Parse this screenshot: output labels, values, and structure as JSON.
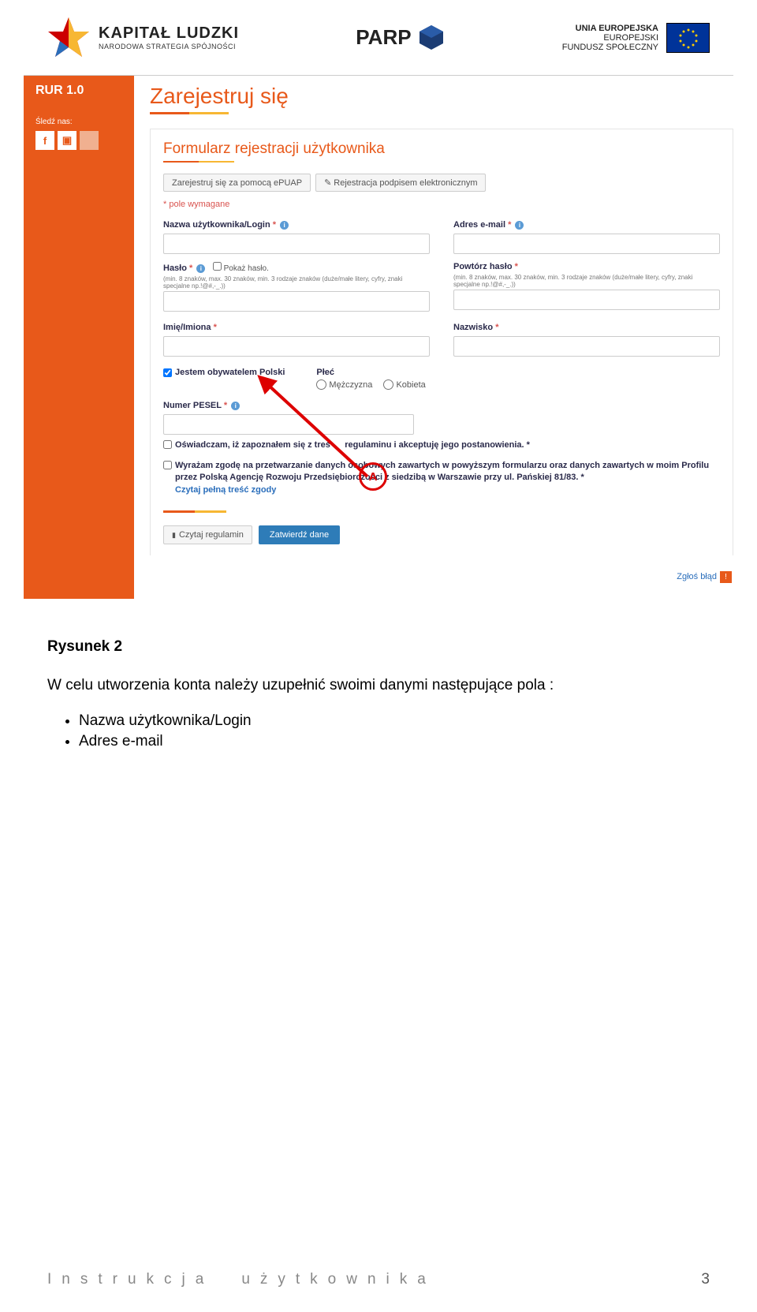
{
  "header": {
    "kl_title": "KAPITAŁ LUDZKI",
    "kl_sub": "NARODOWA STRATEGIA SPÓJNOŚCI",
    "parp": "PARP",
    "eu_line1": "UNIA EUROPEJSKA",
    "eu_line2": "EUROPEJSKI",
    "eu_line3": "FUNDUSZ SPOŁECZNY"
  },
  "sidebar": {
    "title": "RUR 1.0",
    "follow": "Śledź nas:",
    "soc_fb": "f",
    "soc_yt": "▣"
  },
  "main": {
    "h1": "Zarejestruj się",
    "h2": "Formularz rejestracji użytkownika",
    "btn_epuap": "Zarejestruj się za pomocą ePUAP",
    "btn_sig": "Rejestracja podpisem elektronicznym",
    "req": "* pole wymagane",
    "login_label": "Nazwa użytkownika/Login",
    "email_label": "Adres e-mail",
    "pass_label": "Hasło",
    "show_pass": "Pokaż hasło.",
    "pass_hint": "(min. 8 znaków, max. 30 znaków, min. 3 rodzaje znaków (duże/małe litery, cyfry, znaki specjalne np.!@#,-_.))",
    "pass2_label": "Powtórz hasło",
    "pass2_hint": "(min. 8 znaków, max. 30 znaków, min. 3 rodzaje znaków (duże/małe litery, cyfry, znaki specjalne np.!@#,-_.))",
    "name_label": "Imię/Imiona",
    "surname_label": "Nazwisko",
    "citizen": "Jestem obywatelem Polski",
    "gender_label": "Płeć",
    "gender_m": "Mężczyzna",
    "gender_f": "Kobieta",
    "pesel_label": "Numer PESEL",
    "consent1_a": "Oświadczam, iż zapoznałem się z treś",
    "consent1_b": " regulaminu i akceptuję jego postanowienia.",
    "consent2": "Wyrażam zgodę na przetwarzanie danych osobowych zawartych w powyższym formularzu oraz danych zawartych w moim Profilu przez Polską Agencję Rozwoju Przedsiębiorczości z siedzibą w Warszawie przy ul. Pańskiej 81/83.",
    "consent2_link": "Czytaj pełną treść zgody",
    "btn_reg": "Czytaj regulamin",
    "btn_submit": "Zatwierdź dane",
    "report": "Zgłoś błąd",
    "info_i": "i",
    "ast": "*",
    "marker_a": "A"
  },
  "caption": {
    "fig": "Rysunek 2",
    "para": "W celu utworzenia konta należy uzupełnić swoimi danymi następujące pola :",
    "bullets": [
      "Nazwa użytkownika/Login",
      "Adres e-mail"
    ]
  },
  "footer": {
    "w1": "Instrukcja",
    "w2": "użytkownika",
    "page": "3"
  }
}
